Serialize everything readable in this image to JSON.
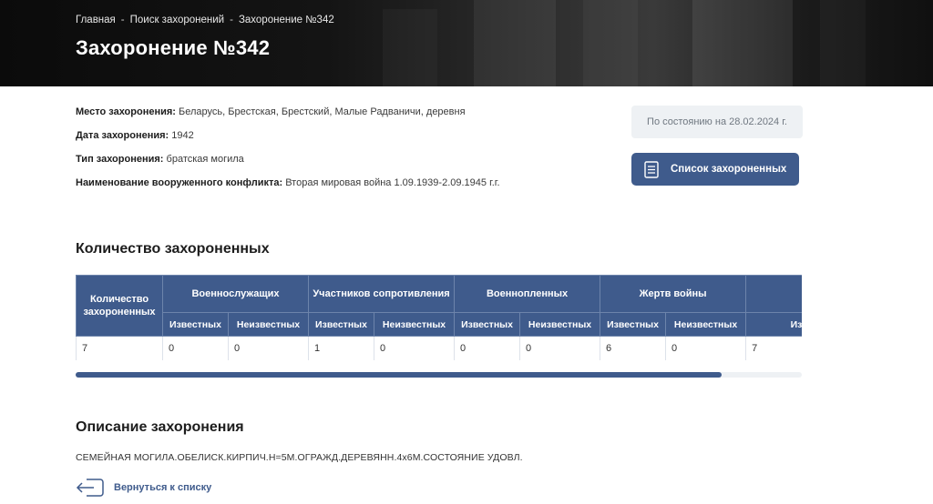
{
  "breadcrumb": {
    "items": [
      "Главная",
      "Поиск захоронений",
      "Захоронение №342"
    ],
    "separator": "-"
  },
  "page_title": "Захоронение №342",
  "info": {
    "place_label": "Место захоронения:",
    "place_value": "Беларусь, Брестская, Брестский, Малые Радваничи, деревня",
    "date_label": "Дата захоронения:",
    "date_value": "1942",
    "type_label": "Тип захоронения:",
    "type_value": "братская могила",
    "conflict_label": "Наименование вооруженного конфликта:",
    "conflict_value": "Вторая мировая война 1.09.1939-2.09.1945 г.г."
  },
  "status_text": "По состоянию на 28.02.2024 г.",
  "list_button_label": "Список захороненных",
  "count_section": {
    "title": "Количество захороненных",
    "table": {
      "total_header": "Количество захороненных",
      "groups": [
        "Военнослужащих",
        "Участников сопротивления",
        "Военнопленных",
        "Жертв войны",
        ""
      ],
      "subheaders": [
        "Известных",
        "Неизвестных",
        "Известных",
        "Неизвестных",
        "Известных",
        "Неизвестных",
        "Известных",
        "Неизвестных",
        "Известных"
      ],
      "row": [
        "7",
        "0",
        "0",
        "1",
        "0",
        "0",
        "0",
        "6",
        "0",
        "7"
      ]
    },
    "scroll_fraction": 0.89
  },
  "description_section": {
    "title": "Описание захоронения",
    "text": "СЕМЕЙНАЯ МОГИЛА.ОБЕЛИСК.КИРПИЧ.Н=5М.ОГРАЖД.ДЕРЕВЯНН.4х6М.СОСТОЯНИЕ УДОВЛ."
  },
  "back_link_label": "Вернуться к списку",
  "colors": {
    "accent": "#3f5b8c",
    "status_bg": "#eef1f4",
    "header_dark": "#111111"
  },
  "icons": {
    "list_button": "document-list-icon",
    "back_link": "arrow-left-icon"
  }
}
